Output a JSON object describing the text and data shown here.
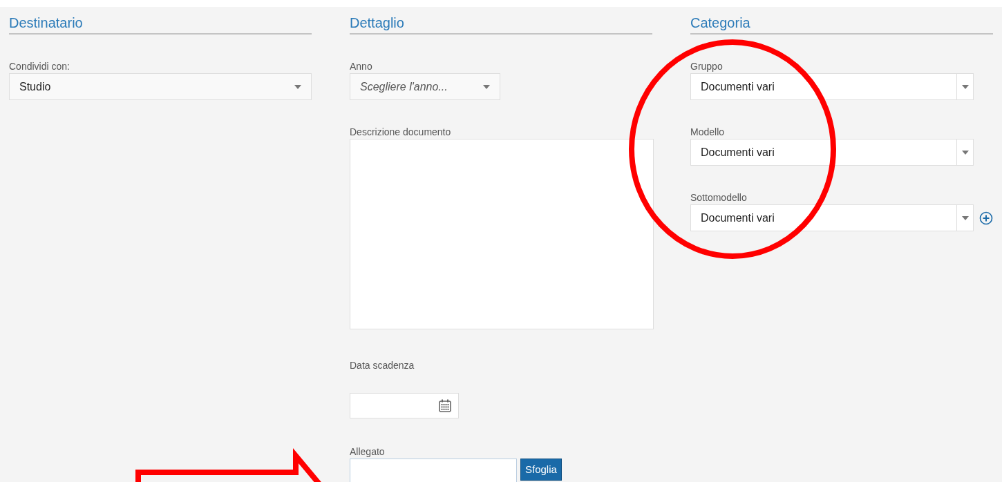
{
  "columns": [
    {
      "title": "Destinatario",
      "fields": [
        {
          "kind": "select",
          "label": "Condividi con:",
          "value": "Studio"
        }
      ]
    },
    {
      "title": "Dettaglio",
      "fields": [
        {
          "kind": "select",
          "label": "Anno",
          "placeholder": "Scegliere l'anno..."
        },
        {
          "kind": "textarea",
          "label": "Descrizione documento"
        },
        {
          "kind": "date",
          "label": "Data scadenza"
        },
        {
          "kind": "file",
          "label": "Allegato",
          "button": "Sfoglia"
        }
      ]
    },
    {
      "title": "Categoria",
      "fields": [
        {
          "kind": "combo",
          "label": "Gruppo",
          "value": "Documenti vari",
          "add_button": false
        },
        {
          "kind": "combo",
          "label": "Modello",
          "value": "Documenti vari",
          "add_button": false
        },
        {
          "kind": "combo",
          "label": "Sottomodello",
          "value": "Documenti vari",
          "add_button": true
        }
      ]
    }
  ]
}
